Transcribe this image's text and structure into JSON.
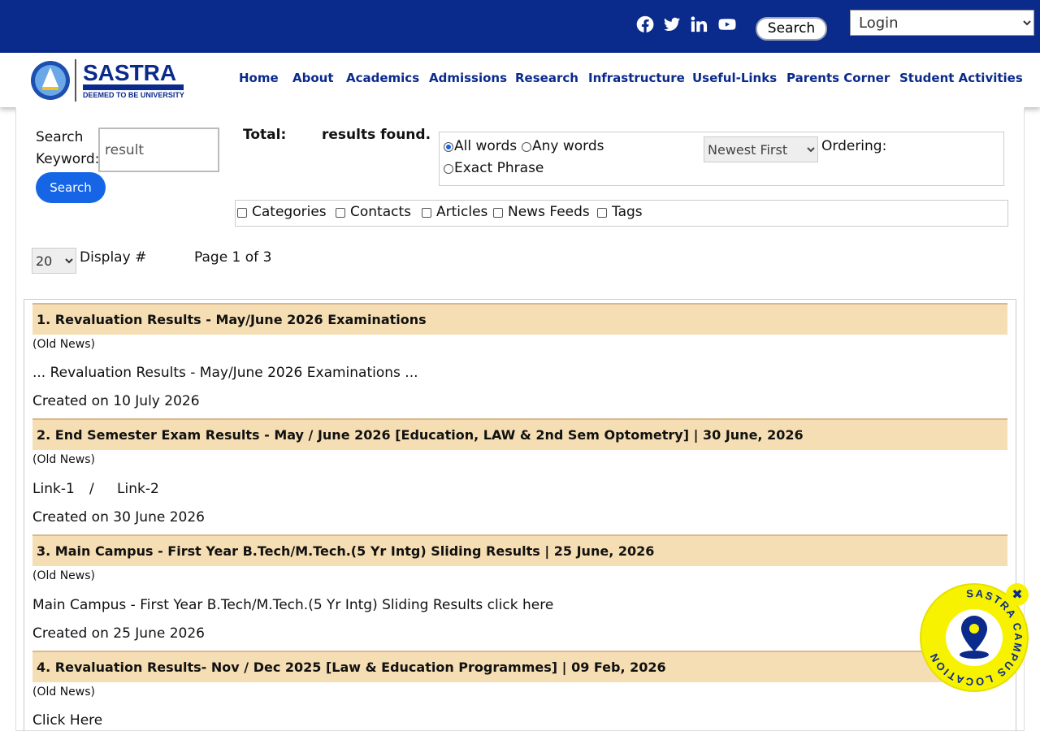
{
  "topbar": {
    "social_icons": [
      "facebook-icon",
      "twitter-icon",
      "linkedin-icon",
      "youtube-icon"
    ],
    "search_label": "Search",
    "login_select": "Login",
    "bg_color": "#0a2a8c"
  },
  "header": {
    "logo_text": "SASTRA",
    "logo_subtext": "DEEMED TO BE UNIVERSITY",
    "nav": [
      "Home",
      "About",
      "Academics",
      "Admissions",
      "Research",
      "Infrastructure",
      "Useful-Links",
      "Parents Corner",
      "Student Activities"
    ]
  },
  "search_form": {
    "keyword_label_1": "Search",
    "keyword_label_2": "Keyword:",
    "keyword_value": "result",
    "search_button": "Search",
    "total_label": "Total:",
    "results_found": "results found.",
    "phrase_all": "All words",
    "phrase_any": "Any words",
    "phrase_exact": "Exact Phrase",
    "ordering_value": "Newest First",
    "ordering_label": "Ordering:",
    "areas": [
      "Categories",
      "Contacts",
      "Articles",
      "News Feeds",
      "Tags"
    ],
    "limit_value": "20",
    "display_label": "Display #",
    "page_info": "Page 1 of 3"
  },
  "results": [
    {
      "title": "1. Revaluation Results - May/June 2026 Examinations",
      "category": "(Old News)",
      "text": "... Revaluation Results - May/June 2026 Examinations ...",
      "date": "Created on 10 July 2026"
    },
    {
      "title": "2. End Semester Exam Results - May / June 2026 [Education, LAW & 2nd Sem Optometry] | 30 June, 2026",
      "category": "(Old News)",
      "link1": "Link-1",
      "sep": "/",
      "link2": "Link-2",
      "date": "Created on 30 June 2026"
    },
    {
      "title": "3. Main Campus - First Year B.Tech/M.Tech.(5 Yr Intg) Sliding Results | 25 June, 2026",
      "category": "(Old News)",
      "text": "Main Campus - First Year B.Tech/M.Tech.(5 Yr Intg) Sliding Results click here",
      "date": "Created on 25 June 2026"
    },
    {
      "title": "4. Revaluation Results- Nov / Dec 2025 [Law & Education Programmes] | 09 Feb, 2026",
      "category": "(Old News)",
      "text": "Click Here"
    }
  ],
  "campus_badge": {
    "text": "SASTRA CAMPUS LOCATION",
    "close": "✖"
  }
}
